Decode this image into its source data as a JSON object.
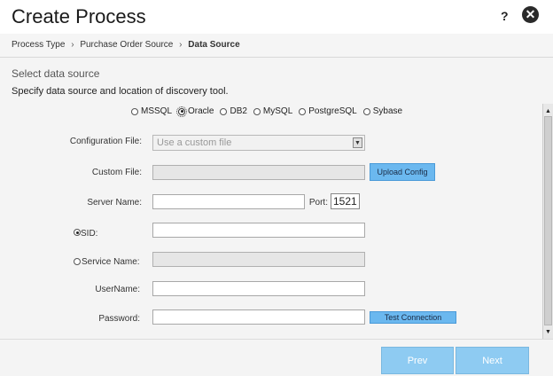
{
  "window": {
    "title": "Create Process",
    "help_label": "?",
    "close_label": "✕"
  },
  "breadcrumb": {
    "step1": "Process Type",
    "step2": "Purchase Order Source",
    "step3": "Data Source",
    "separator": "›"
  },
  "section": {
    "title": "Select data source",
    "description": "Specify data source and location of discovery tool."
  },
  "db_options": [
    {
      "label": "MSSQL",
      "checked": false
    },
    {
      "label": "Oracle",
      "checked": true
    },
    {
      "label": "DB2",
      "checked": false
    },
    {
      "label": "MySQL",
      "checked": false
    },
    {
      "label": "PostgreSQL",
      "checked": false
    },
    {
      "label": "Sybase",
      "checked": false
    }
  ],
  "form": {
    "config_file_label": "Configuration File:",
    "config_file_value": "Use a custom file",
    "custom_file_label": "Custom File:",
    "custom_file_value": "",
    "upload_button": "Upload Config",
    "server_name_label": "Server Name:",
    "server_name_value": "",
    "port_label": "Port:",
    "port_value": "1521",
    "sid_label": "SID:",
    "sid_checked": true,
    "sid_value": "",
    "service_name_label": "Service Name:",
    "service_name_checked": false,
    "service_name_value": "",
    "username_label": "UserName:",
    "username_value": "",
    "password_label": "Password:",
    "password_value": "",
    "test_connection_button": "Test Connection"
  },
  "footer": {
    "prev_label": "Prev",
    "next_label": "Next"
  },
  "colors": {
    "accent": "#6bb8ef",
    "nav_button": "#8ecbf2"
  }
}
